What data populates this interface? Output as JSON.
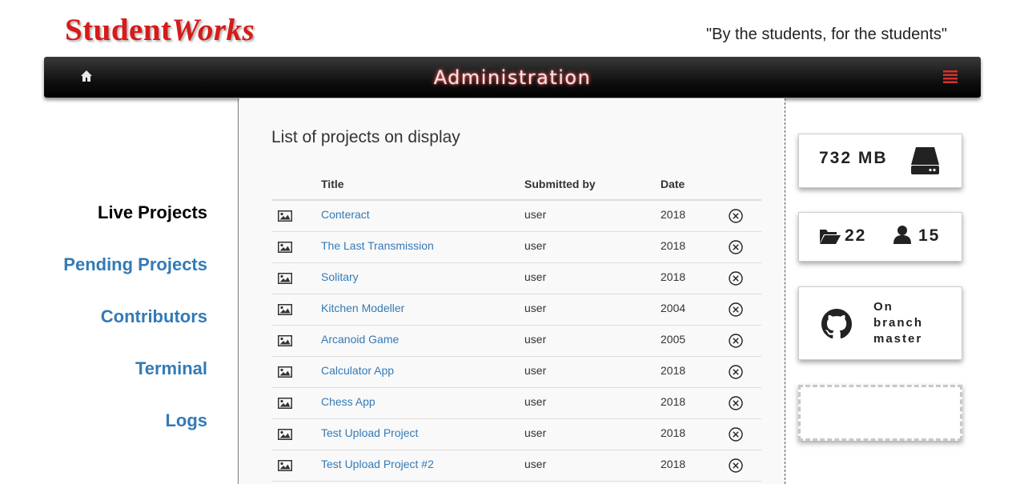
{
  "header": {
    "logo_part1": "Student",
    "logo_part2": "Works",
    "tagline": "\"By the students, for the students\""
  },
  "navbar": {
    "title": "Administration",
    "home_icon": "home-icon",
    "menu_icon": "menu-icon"
  },
  "sidebar": {
    "items": [
      {
        "label": "Live Projects",
        "active": true
      },
      {
        "label": "Pending Projects",
        "active": false
      },
      {
        "label": "Contributors",
        "active": false
      },
      {
        "label": "Terminal",
        "active": false
      },
      {
        "label": "Logs",
        "active": false
      }
    ]
  },
  "main": {
    "heading": "List of projects on display",
    "columns": [
      "",
      "Title",
      "Submitted by",
      "Date",
      ""
    ],
    "rows": [
      {
        "title": "Conteract",
        "submitted_by": "user",
        "date": "2018"
      },
      {
        "title": "The Last Transmission",
        "submitted_by": "user",
        "date": "2018"
      },
      {
        "title": "Solitary",
        "submitted_by": "user",
        "date": "2018"
      },
      {
        "title": "Kitchen Modeller",
        "submitted_by": "user",
        "date": "2004"
      },
      {
        "title": "Arcanoid Game",
        "submitted_by": "user",
        "date": "2005"
      },
      {
        "title": "Calculator App",
        "submitted_by": "user",
        "date": "2018"
      },
      {
        "title": "Chess App",
        "submitted_by": "user",
        "date": "2018"
      },
      {
        "title": "Test Upload Project",
        "submitted_by": "user",
        "date": "2018"
      },
      {
        "title": "Test Upload Project #2",
        "submitted_by": "user",
        "date": "2018"
      }
    ]
  },
  "stats": {
    "storage": "732 MB",
    "projects_count": "22",
    "users_count": "15",
    "branch_line1": "On",
    "branch_line2": "branch",
    "branch_line3": "master"
  },
  "colors": {
    "logo_red": "#d71a1a",
    "link_blue": "#337ab7",
    "menu_red": "#d9302c"
  }
}
